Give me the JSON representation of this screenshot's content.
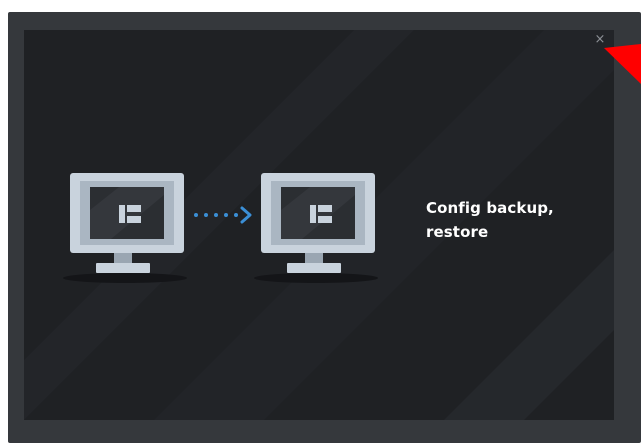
{
  "dialog": {
    "close_label": "×",
    "caption": "Config backup, restore"
  },
  "icons": {
    "close": "close-icon",
    "source_monitor": "monitor-icon",
    "target_monitor": "monitor-icon",
    "transfer_arrow": "dotted-arrow-icon",
    "cursor": "red-pointer-icon"
  },
  "colors": {
    "outer_frame": "#35383c",
    "panel_bg": "#1f2124",
    "monitor_frame": "#c9d3dd",
    "monitor_screen": "#2b2e32",
    "arrow": "#3b8fd6",
    "text": "#ffffff",
    "pointer": "#ff0000"
  }
}
